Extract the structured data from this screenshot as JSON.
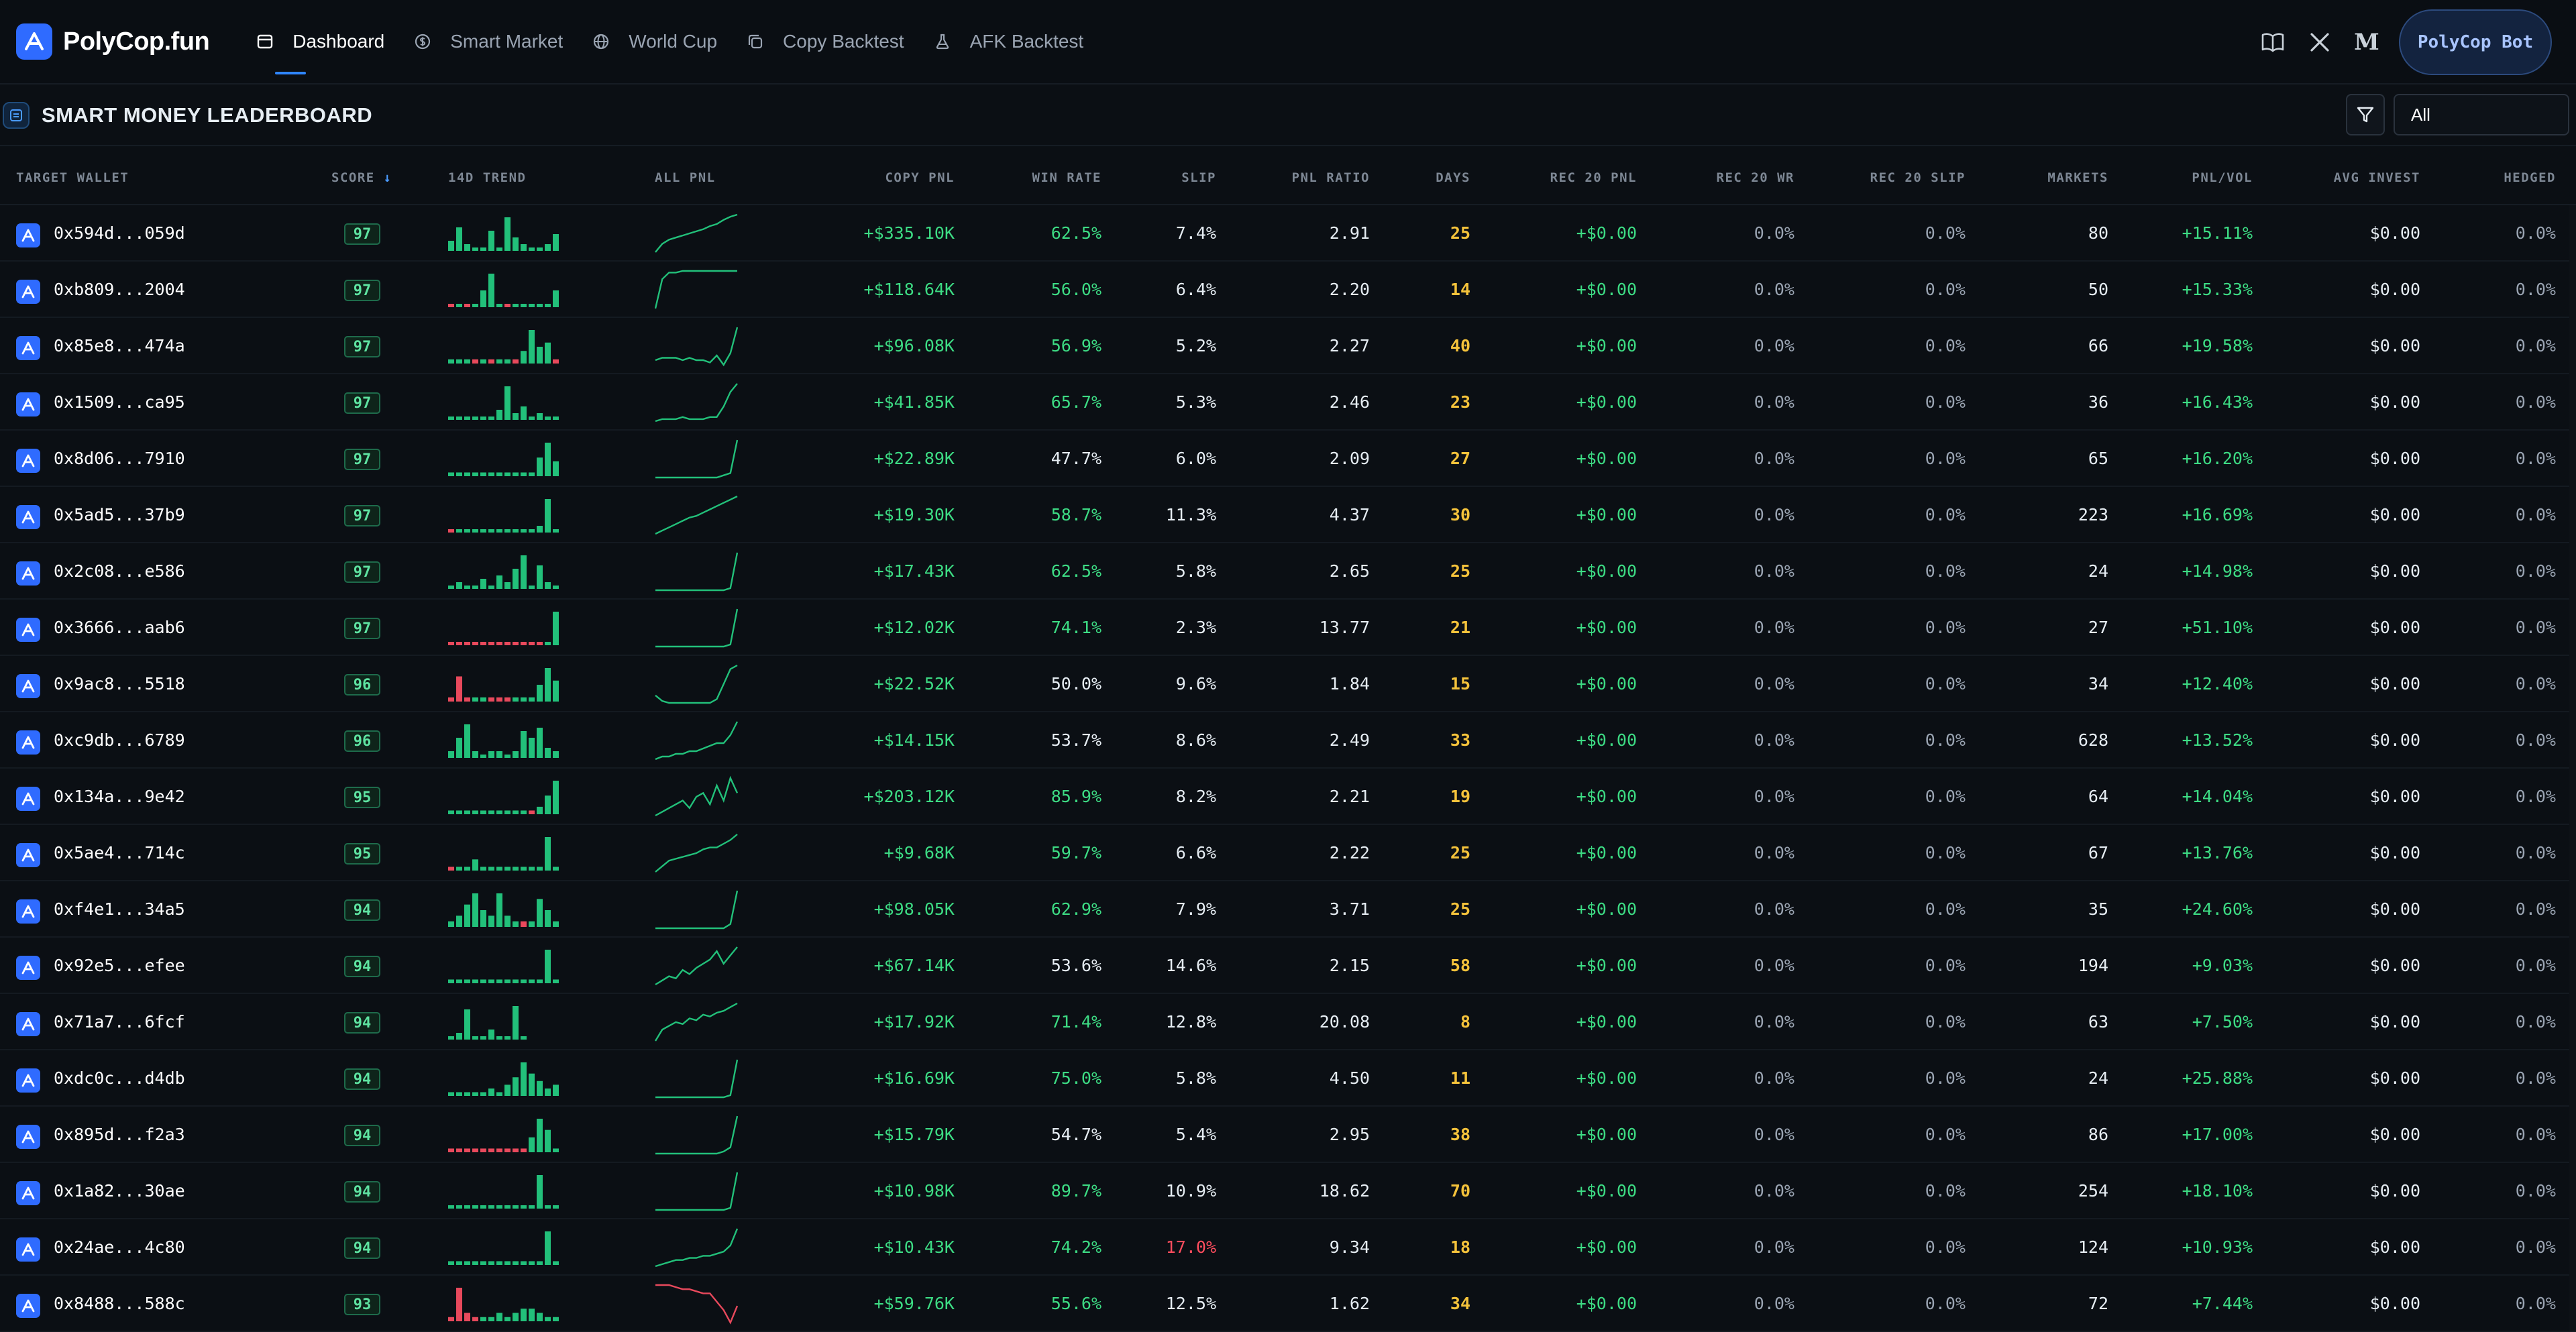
{
  "app": {
    "brand": "PolyCop.fun",
    "bot_button": "PolyCop Bot"
  },
  "nav": [
    {
      "label": "Dashboard",
      "icon": "dashboard-icon",
      "active": true
    },
    {
      "label": "Smart Market",
      "icon": "dollar-circle-icon",
      "active": false
    },
    {
      "label": "World Cup",
      "icon": "globe-icon",
      "active": false
    },
    {
      "label": "Copy Backtest",
      "icon": "copy-icon",
      "active": false
    },
    {
      "label": "AFK Backtest",
      "icon": "flask-icon",
      "active": false
    }
  ],
  "header_icons": [
    "book-icon",
    "x-logo-icon",
    "medium-logo-icon"
  ],
  "section": {
    "title": "SMART MONEY LEADERBOARD",
    "filter_value": "All"
  },
  "columns": {
    "wallet": "TARGET WALLET",
    "score": "SCORE",
    "trend": "14D TREND",
    "allpnl": "ALL PNL",
    "copypnl": "COPY PNL",
    "winrate": "WIN RATE",
    "slip": "SLIP",
    "ratio": "PNL RATIO",
    "days": "DAYS",
    "rec20pnl": "REC 20 PNL",
    "rec20wr": "REC 20 WR",
    "rec20slip": "REC 20 SLIP",
    "markets": "MARKETS",
    "pnlvol": "PNL/VOL",
    "avginvest": "AVG INVEST",
    "hedged": "HEDGED"
  },
  "sort_indicator": "↓",
  "colors": {
    "positive": "#3ddc84",
    "negative": "#ff4d5e",
    "days": "#f5c33b",
    "accent": "#2f6bff"
  },
  "rows": [
    {
      "wallet": "0x594d...059d",
      "score": "97",
      "copy_pnl": "+$335.10K",
      "win_rate": "62.5%",
      "slip": "7.4%",
      "ratio": "2.91",
      "days": "25",
      "rec20_pnl": "+$0.00",
      "rec20_wr": "0.0%",
      "rec20_slip": "0.0%",
      "markets": "80",
      "pnl_vol": "+15.11%",
      "avg_invest": "$0.00",
      "hedged": "0.0%",
      "trend": [
        3,
        7,
        2,
        1,
        1,
        6,
        1,
        10,
        4,
        2,
        1,
        1,
        2,
        5
      ],
      "pnl": [
        2,
        10,
        14,
        16,
        18,
        20,
        22,
        24,
        27,
        29,
        33,
        36,
        38
      ]
    },
    {
      "wallet": "0xb809...2004",
      "score": "97",
      "copy_pnl": "+$118.64K",
      "win_rate": "56.0%",
      "slip": "6.4%",
      "ratio": "2.20",
      "days": "14",
      "rec20_pnl": "+$0.00",
      "rec20_wr": "0.0%",
      "rec20_slip": "0.0%",
      "markets": "50",
      "pnl_vol": "+15.33%",
      "avg_invest": "$0.00",
      "hedged": "0.0%",
      "trend": [
        -1,
        1,
        -1,
        1,
        5,
        10,
        1,
        -1,
        1,
        1,
        1,
        1,
        1,
        5
      ],
      "pnl": [
        2,
        20,
        24,
        24,
        25,
        25,
        25,
        25,
        25,
        25,
        25,
        25,
        25
      ]
    },
    {
      "wallet": "0x85e8...474a",
      "score": "97",
      "copy_pnl": "+$96.08K",
      "win_rate": "56.9%",
      "slip": "5.2%",
      "ratio": "2.27",
      "days": "40",
      "rec20_pnl": "+$0.00",
      "rec20_wr": "0.0%",
      "rec20_slip": "0.0%",
      "markets": "66",
      "pnl_vol": "+19.58%",
      "avg_invest": "$0.00",
      "hedged": "0.0%",
      "trend": [
        1,
        1,
        1,
        -1,
        1,
        -1,
        1,
        1,
        -1,
        3,
        8,
        4,
        5,
        -1
      ],
      "pnl": [
        6,
        7,
        7,
        7,
        6,
        7,
        6,
        6,
        5,
        8,
        4,
        9,
        20
      ]
    },
    {
      "wallet": "0x1509...ca95",
      "score": "97",
      "copy_pnl": "+$41.85K",
      "win_rate": "65.7%",
      "slip": "5.3%",
      "ratio": "2.46",
      "days": "23",
      "rec20_pnl": "+$0.00",
      "rec20_wr": "0.0%",
      "rec20_slip": "0.0%",
      "markets": "36",
      "pnl_vol": "+16.43%",
      "avg_invest": "$0.00",
      "hedged": "0.0%",
      "trend": [
        1,
        1,
        1,
        1,
        1,
        1,
        3,
        10,
        2,
        4,
        1,
        2,
        1,
        1
      ],
      "pnl": [
        2,
        3,
        3,
        3,
        4,
        3,
        3,
        3,
        4,
        4,
        9,
        16,
        20
      ]
    },
    {
      "wallet": "0x8d06...7910",
      "score": "97",
      "copy_pnl": "+$22.89K",
      "win_rate": "47.7%",
      "slip": "6.0%",
      "ratio": "2.09",
      "days": "27",
      "rec20_pnl": "+$0.00",
      "rec20_wr": "0.0%",
      "rec20_slip": "0.0%",
      "markets": "65",
      "pnl_vol": "+16.20%",
      "avg_invest": "$0.00",
      "hedged": "0.0%",
      "trend": [
        1,
        1,
        1,
        1,
        1,
        1,
        1,
        1,
        1,
        1,
        1,
        5,
        9,
        4
      ],
      "pnl": [
        3,
        3,
        3,
        3,
        3,
        3,
        3,
        3,
        3,
        3,
        4,
        5,
        20
      ]
    },
    {
      "wallet": "0x5ad5...37b9",
      "score": "97",
      "copy_pnl": "+$19.30K",
      "win_rate": "58.7%",
      "slip": "11.3%",
      "ratio": "4.37",
      "days": "30",
      "rec20_pnl": "+$0.00",
      "rec20_wr": "0.0%",
      "rec20_slip": "0.0%",
      "markets": "223",
      "pnl_vol": "+16.69%",
      "avg_invest": "$0.00",
      "hedged": "0.0%",
      "trend": [
        -1,
        1,
        1,
        1,
        1,
        1,
        1,
        1,
        1,
        1,
        1,
        2,
        10,
        1
      ],
      "pnl": [
        2,
        4,
        6,
        8,
        10,
        12,
        13,
        15,
        17,
        19,
        21,
        23,
        25
      ]
    },
    {
      "wallet": "0x2c08...e586",
      "score": "97",
      "copy_pnl": "+$17.43K",
      "win_rate": "62.5%",
      "slip": "5.8%",
      "ratio": "2.65",
      "days": "25",
      "rec20_pnl": "+$0.00",
      "rec20_wr": "0.0%",
      "rec20_slip": "0.0%",
      "markets": "24",
      "pnl_vol": "+14.98%",
      "avg_invest": "$0.00",
      "hedged": "0.0%",
      "trend": [
        1,
        2,
        1,
        1,
        3,
        1,
        4,
        2,
        6,
        10,
        1,
        7,
        2,
        1
      ],
      "pnl": [
        2,
        2,
        2,
        2,
        2,
        2,
        2,
        2,
        2,
        2,
        2,
        3,
        20
      ]
    },
    {
      "wallet": "0x3666...aab6",
      "score": "97",
      "copy_pnl": "+$12.02K",
      "win_rate": "74.1%",
      "slip": "2.3%",
      "ratio": "13.77",
      "days": "21",
      "rec20_pnl": "+$0.00",
      "rec20_wr": "0.0%",
      "rec20_slip": "0.0%",
      "markets": "27",
      "pnl_vol": "+51.10%",
      "avg_invest": "$0.00",
      "hedged": "0.0%",
      "trend": [
        -1,
        -1,
        -1,
        -1,
        -1,
        -1,
        -1,
        -1,
        -1,
        -1,
        -1,
        -1,
        1,
        10
      ],
      "pnl": [
        2,
        2,
        2,
        2,
        2,
        2,
        2,
        2,
        2,
        2,
        2,
        3,
        20
      ]
    },
    {
      "wallet": "0x9ac8...5518",
      "score": "96",
      "copy_pnl": "+$22.52K",
      "win_rate": "50.0%",
      "slip": "9.6%",
      "ratio": "1.84",
      "days": "15",
      "rec20_pnl": "+$0.00",
      "rec20_wr": "0.0%",
      "rec20_slip": "0.0%",
      "markets": "34",
      "pnl_vol": "+12.40%",
      "avg_invest": "$0.00",
      "hedged": "0.0%",
      "trend": [
        -1,
        -6,
        -1,
        1,
        1,
        -1,
        -1,
        -1,
        1,
        1,
        1,
        4,
        8,
        5
      ],
      "pnl": [
        6,
        3,
        2,
        2,
        2,
        2,
        2,
        2,
        2,
        4,
        12,
        20,
        22
      ]
    },
    {
      "wallet": "0xc9db...6789",
      "score": "96",
      "copy_pnl": "+$14.15K",
      "win_rate": "53.7%",
      "slip": "8.6%",
      "ratio": "2.49",
      "days": "33",
      "rec20_pnl": "+$0.00",
      "rec20_wr": "0.0%",
      "rec20_slip": "0.0%",
      "markets": "628",
      "pnl_vol": "+13.52%",
      "avg_invest": "$0.00",
      "hedged": "0.0%",
      "trend": [
        2,
        6,
        10,
        2,
        1,
        2,
        2,
        1,
        2,
        8,
        6,
        9,
        3,
        2
      ],
      "pnl": [
        2,
        3,
        3,
        4,
        4,
        5,
        5,
        6,
        7,
        8,
        8,
        11,
        16
      ]
    },
    {
      "wallet": "0x134a...9e42",
      "score": "95",
      "copy_pnl": "+$203.12K",
      "win_rate": "85.9%",
      "slip": "8.2%",
      "ratio": "2.21",
      "days": "19",
      "rec20_pnl": "+$0.00",
      "rec20_wr": "0.0%",
      "rec20_slip": "0.0%",
      "markets": "64",
      "pnl_vol": "+14.04%",
      "avg_invest": "$0.00",
      "hedged": "0.0%",
      "trend": [
        1,
        1,
        1,
        1,
        1,
        1,
        1,
        1,
        1,
        1,
        -1,
        2,
        5,
        9
      ],
      "pnl": [
        6,
        7,
        8,
        9,
        10,
        8,
        11,
        12,
        9,
        14,
        10,
        16,
        12
      ]
    },
    {
      "wallet": "0x5ae4...714c",
      "score": "95",
      "copy_pnl": "+$9.68K",
      "win_rate": "59.7%",
      "slip": "6.6%",
      "ratio": "2.22",
      "days": "25",
      "rec20_pnl": "+$0.00",
      "rec20_wr": "0.0%",
      "rec20_slip": "0.0%",
      "markets": "67",
      "pnl_vol": "+13.76%",
      "avg_invest": "$0.00",
      "hedged": "0.0%",
      "trend": [
        -1,
        1,
        1,
        3,
        1,
        1,
        1,
        1,
        1,
        1,
        1,
        1,
        9,
        1
      ],
      "pnl": [
        2,
        5,
        8,
        9,
        10,
        11,
        12,
        14,
        15,
        15,
        17,
        19,
        22
      ]
    },
    {
      "wallet": "0xf4e1...34a5",
      "score": "94",
      "copy_pnl": "+$98.05K",
      "win_rate": "62.9%",
      "slip": "7.9%",
      "ratio": "3.71",
      "days": "25",
      "rec20_pnl": "+$0.00",
      "rec20_wr": "0.0%",
      "rec20_slip": "0.0%",
      "markets": "35",
      "pnl_vol": "+24.60%",
      "avg_invest": "$0.00",
      "hedged": "0.0%",
      "trend": [
        1,
        2,
        4,
        6,
        3,
        2,
        6,
        2,
        1,
        -1,
        1,
        5,
        3,
        1
      ],
      "pnl": [
        2,
        2,
        2,
        2,
        2,
        2,
        2,
        2,
        2,
        2,
        2,
        4,
        20
      ]
    },
    {
      "wallet": "0x92e5...efee",
      "score": "94",
      "copy_pnl": "+$67.14K",
      "win_rate": "53.6%",
      "slip": "14.6%",
      "ratio": "2.15",
      "days": "58",
      "rec20_pnl": "+$0.00",
      "rec20_wr": "0.0%",
      "rec20_slip": "0.0%",
      "markets": "194",
      "pnl_vol": "+9.03%",
      "avg_invest": "$0.00",
      "hedged": "0.0%",
      "trend": [
        1,
        1,
        1,
        1,
        1,
        1,
        1,
        1,
        1,
        1,
        1,
        1,
        9,
        1
      ],
      "pnl": [
        2,
        4,
        6,
        5,
        9,
        7,
        10,
        12,
        14,
        18,
        12,
        16,
        20
      ]
    },
    {
      "wallet": "0x71a7...6fcf",
      "score": "94",
      "copy_pnl": "+$17.92K",
      "win_rate": "71.4%",
      "slip": "12.8%",
      "ratio": "20.08",
      "days": "8",
      "rec20_pnl": "+$0.00",
      "rec20_wr": "0.0%",
      "rec20_slip": "0.0%",
      "markets": "63",
      "pnl_vol": "+7.50%",
      "avg_invest": "$0.00",
      "hedged": "0.0%",
      "trend": [
        1,
        2,
        9,
        1,
        1,
        3,
        1,
        1,
        10,
        1,
        0,
        0,
        0,
        0
      ],
      "pnl": [
        2,
        8,
        10,
        12,
        11,
        14,
        13,
        16,
        15,
        17,
        18,
        20,
        22
      ]
    },
    {
      "wallet": "0xdc0c...d4db",
      "score": "94",
      "copy_pnl": "+$16.69K",
      "win_rate": "75.0%",
      "slip": "5.8%",
      "ratio": "4.50",
      "days": "11",
      "rec20_pnl": "+$0.00",
      "rec20_wr": "0.0%",
      "rec20_slip": "0.0%",
      "markets": "24",
      "pnl_vol": "+25.88%",
      "avg_invest": "$0.00",
      "hedged": "0.0%",
      "trend": [
        1,
        1,
        1,
        1,
        1,
        2,
        1,
        3,
        5,
        9,
        6,
        4,
        2,
        3
      ],
      "pnl": [
        2,
        2,
        2,
        2,
        2,
        2,
        2,
        2,
        2,
        2,
        2,
        3,
        20
      ]
    },
    {
      "wallet": "0x895d...f2a3",
      "score": "94",
      "copy_pnl": "+$15.79K",
      "win_rate": "54.7%",
      "slip": "5.4%",
      "ratio": "2.95",
      "days": "38",
      "rec20_pnl": "+$0.00",
      "rec20_wr": "0.0%",
      "rec20_slip": "0.0%",
      "markets": "86",
      "pnl_vol": "+17.00%",
      "avg_invest": "$0.00",
      "hedged": "0.0%",
      "trend": [
        -1,
        -1,
        -1,
        -1,
        -1,
        -1,
        -1,
        -1,
        -1,
        -1,
        4,
        9,
        6,
        1
      ],
      "pnl": [
        2,
        2,
        2,
        2,
        2,
        2,
        2,
        2,
        2,
        2,
        3,
        5,
        20
      ]
    },
    {
      "wallet": "0x1a82...30ae",
      "score": "94",
      "copy_pnl": "+$10.98K",
      "win_rate": "89.7%",
      "slip": "10.9%",
      "ratio": "18.62",
      "days": "70",
      "rec20_pnl": "+$0.00",
      "rec20_wr": "0.0%",
      "rec20_slip": "0.0%",
      "markets": "254",
      "pnl_vol": "+18.10%",
      "avg_invest": "$0.00",
      "hedged": "0.0%",
      "trend": [
        1,
        1,
        1,
        1,
        1,
        1,
        1,
        1,
        1,
        1,
        1,
        10,
        1,
        1
      ],
      "pnl": [
        2,
        2,
        2,
        2,
        2,
        2,
        2,
        2,
        2,
        2,
        2,
        3,
        20
      ]
    },
    {
      "wallet": "0x24ae...4c80",
      "score": "94",
      "copy_pnl": "+$10.43K",
      "win_rate": "74.2%",
      "slip": "17.0%",
      "ratio": "9.34",
      "days": "18",
      "rec20_pnl": "+$0.00",
      "rec20_wr": "0.0%",
      "rec20_slip": "0.0%",
      "markets": "124",
      "pnl_vol": "+10.93%",
      "avg_invest": "$0.00",
      "hedged": "0.0%",
      "trend": [
        1,
        1,
        1,
        1,
        1,
        1,
        1,
        1,
        1,
        1,
        1,
        1,
        9,
        1
      ],
      "pnl": [
        2,
        3,
        4,
        5,
        5,
        6,
        6,
        7,
        7,
        8,
        9,
        12,
        20
      ]
    },
    {
      "wallet": "0x8488...588c",
      "score": "93",
      "copy_pnl": "+$59.76K",
      "win_rate": "55.6%",
      "slip": "12.5%",
      "ratio": "1.62",
      "days": "34",
      "rec20_pnl": "+$0.00",
      "rec20_wr": "0.0%",
      "rec20_slip": "0.0%",
      "markets": "72",
      "pnl_vol": "+7.44%",
      "avg_invest": "$0.00",
      "hedged": "0.0%",
      "trend": [
        -1,
        -8,
        -2,
        -1,
        1,
        1,
        2,
        1,
        2,
        3,
        3,
        2,
        1,
        1
      ],
      "pnl": [
        20,
        20,
        20,
        19,
        18,
        18,
        17,
        16,
        16,
        12,
        8,
        2,
        10
      ],
      "negative_pnl": true
    }
  ]
}
